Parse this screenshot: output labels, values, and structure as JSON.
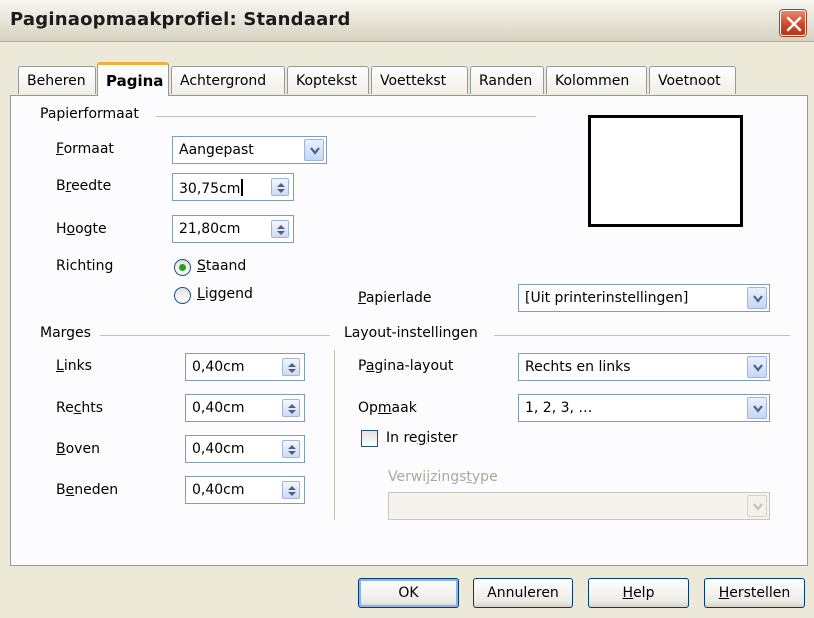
{
  "window": {
    "title": "Paginaopmaakprofiel: Standaard"
  },
  "tabs": [
    {
      "label": "Beheren"
    },
    {
      "label": "Pagina"
    },
    {
      "label": "Achtergrond"
    },
    {
      "label": "Koptekst"
    },
    {
      "label": "Voettekst"
    },
    {
      "label": "Randen"
    },
    {
      "label": "Kolommen"
    },
    {
      "label": "Voetnoot"
    }
  ],
  "active_tab": "Pagina",
  "paper": {
    "group": "Papierformaat",
    "format_label": "Formaat",
    "format_value": "Aangepast",
    "width_label": "Breedte",
    "width_value": "30,75cm",
    "height_label": "Hoogte",
    "height_value": "21,80cm",
    "orientation_label": "Richting",
    "portrait": "Staand",
    "landscape": "Liggend",
    "orientation_selected": "Staand",
    "tray_label": "Papierlade",
    "tray_value": "[Uit printerinstellingen]"
  },
  "margins": {
    "group": "Marges",
    "left_label": "Links",
    "left_value": "0,40cm",
    "right_label": "Rechts",
    "right_value": "0,40cm",
    "top_label": "Boven",
    "top_value": "0,40cm",
    "bottom_label": "Beneden",
    "bottom_value": "0,40cm"
  },
  "layout": {
    "group": "Layout-instellingen",
    "page_layout_label": "Pagina-layout",
    "page_layout_value": "Rechts en links",
    "format_label": "Opmaak",
    "format_value": "1, 2, 3, …",
    "register_label": "In register",
    "register_checked": false,
    "reference_label": "Verwijzingstype",
    "reference_value": ""
  },
  "buttons": {
    "ok": "OK",
    "cancel": "Annuleren",
    "help": "Help",
    "reset": "Herstellen"
  },
  "colors": {
    "accent_tab": "#f0b13a",
    "close": "#cc4422",
    "dialog_bg": "#ece9d8",
    "radio_dot": "#21a121"
  }
}
